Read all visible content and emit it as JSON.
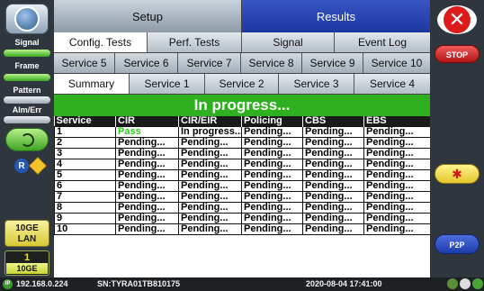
{
  "left_sidebar": {
    "signal": "Signal",
    "frame": "Frame",
    "pattern": "Pattern",
    "alm_err": "Alm/Err",
    "r_icon": "R",
    "port_lines": [
      "10GE",
      "LAN"
    ],
    "slot_number": "1",
    "slot_label": "10GE"
  },
  "right_sidebar": {
    "close_glyph": "✕",
    "stop_label": "STOP",
    "laser_glyph": "✱",
    "p2p_label": "P2P"
  },
  "top_tabs": {
    "setup": "Setup",
    "results": "Results"
  },
  "sub_tabs": [
    "Config. Tests",
    "Perf. Tests",
    "Signal",
    "Event Log"
  ],
  "service_tabs": [
    "Service 5",
    "Service 6",
    "Service 7",
    "Service 8",
    "Service 9",
    "Service 10"
  ],
  "summary_tabs": [
    "Summary",
    "Service 1",
    "Service 2",
    "Service 3",
    "Service 4"
  ],
  "status": "In progress...",
  "table": {
    "headers": [
      "Service",
      "CIR",
      "CIR/EIR",
      "Policing",
      "CBS",
      "EBS"
    ],
    "rows": [
      [
        "1",
        "Pass",
        "In progress...",
        "Pending...",
        "Pending...",
        "Pending..."
      ],
      [
        "2",
        "Pending...",
        "Pending...",
        "Pending...",
        "Pending...",
        "Pending..."
      ],
      [
        "3",
        "Pending...",
        "Pending...",
        "Pending...",
        "Pending...",
        "Pending..."
      ],
      [
        "4",
        "Pending...",
        "Pending...",
        "Pending...",
        "Pending...",
        "Pending..."
      ],
      [
        "5",
        "Pending...",
        "Pending...",
        "Pending...",
        "Pending...",
        "Pending..."
      ],
      [
        "6",
        "Pending...",
        "Pending...",
        "Pending...",
        "Pending...",
        "Pending..."
      ],
      [
        "7",
        "Pending...",
        "Pending...",
        "Pending...",
        "Pending...",
        "Pending..."
      ],
      [
        "8",
        "Pending...",
        "Pending...",
        "Pending...",
        "Pending...",
        "Pending..."
      ],
      [
        "9",
        "Pending...",
        "Pending...",
        "Pending...",
        "Pending...",
        "Pending..."
      ],
      [
        "10",
        "Pending...",
        "Pending...",
        "Pending...",
        "Pending...",
        "Pending..."
      ]
    ]
  },
  "status_bar": {
    "ip_badge": "IP",
    "ip": "192.168.0.224",
    "serial": "SN:TYRA01TB810175",
    "datetime": "2020-08-04  17:41:00"
  },
  "colors": {
    "status_green": "#2fb11f",
    "results_blue": "#1d37a0",
    "pass_green": "#2bcc1c"
  }
}
